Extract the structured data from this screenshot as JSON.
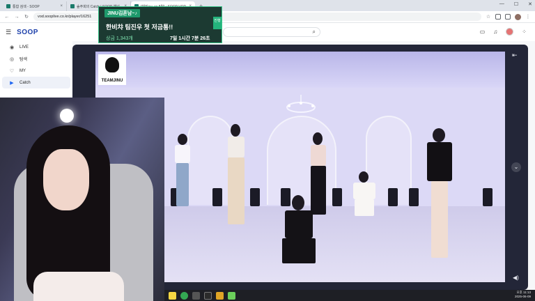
{
  "browser": {
    "tabs": [
      {
        "title": "통합 검색 - SOOP",
        "close": "×"
      },
      {
        "title": "숲주회의 Catch | SOOP 채널",
        "close": "×"
      },
      {
        "title": "[채진jeu up 8월] : SOOP VOD",
        "close": "×"
      }
    ],
    "new_tab": "+",
    "url": "vod.sooplive.co.kr/player/16251"
  },
  "app": {
    "logo": "SOOP",
    "sidebar": [
      {
        "label": "LIVE",
        "icon": "live-icon"
      },
      {
        "label": "탐색",
        "icon": "compass-icon"
      },
      {
        "label": "MY",
        "icon": "heart-icon"
      },
      {
        "label": "Catch",
        "icon": "catch-play-icon"
      }
    ]
  },
  "notice": {
    "tag": "JINU김혼남~♪",
    "title": "한비챠 팀진우 첫 저금통!!",
    "amount": "상금 1,343개",
    "time": "7일 1시간  7분 26초",
    "badge": "진행"
  },
  "video": {
    "team_logo": "TEAMJINU"
  },
  "taskbar": {
    "clock_time": "오후 11:13",
    "clock_date": "2025-06-09"
  },
  "colors": {
    "brand": "#1c3faa",
    "notice_bg": "#1c3a32",
    "notice_accent": "#1e9a6c",
    "player_bg": "#232638"
  }
}
